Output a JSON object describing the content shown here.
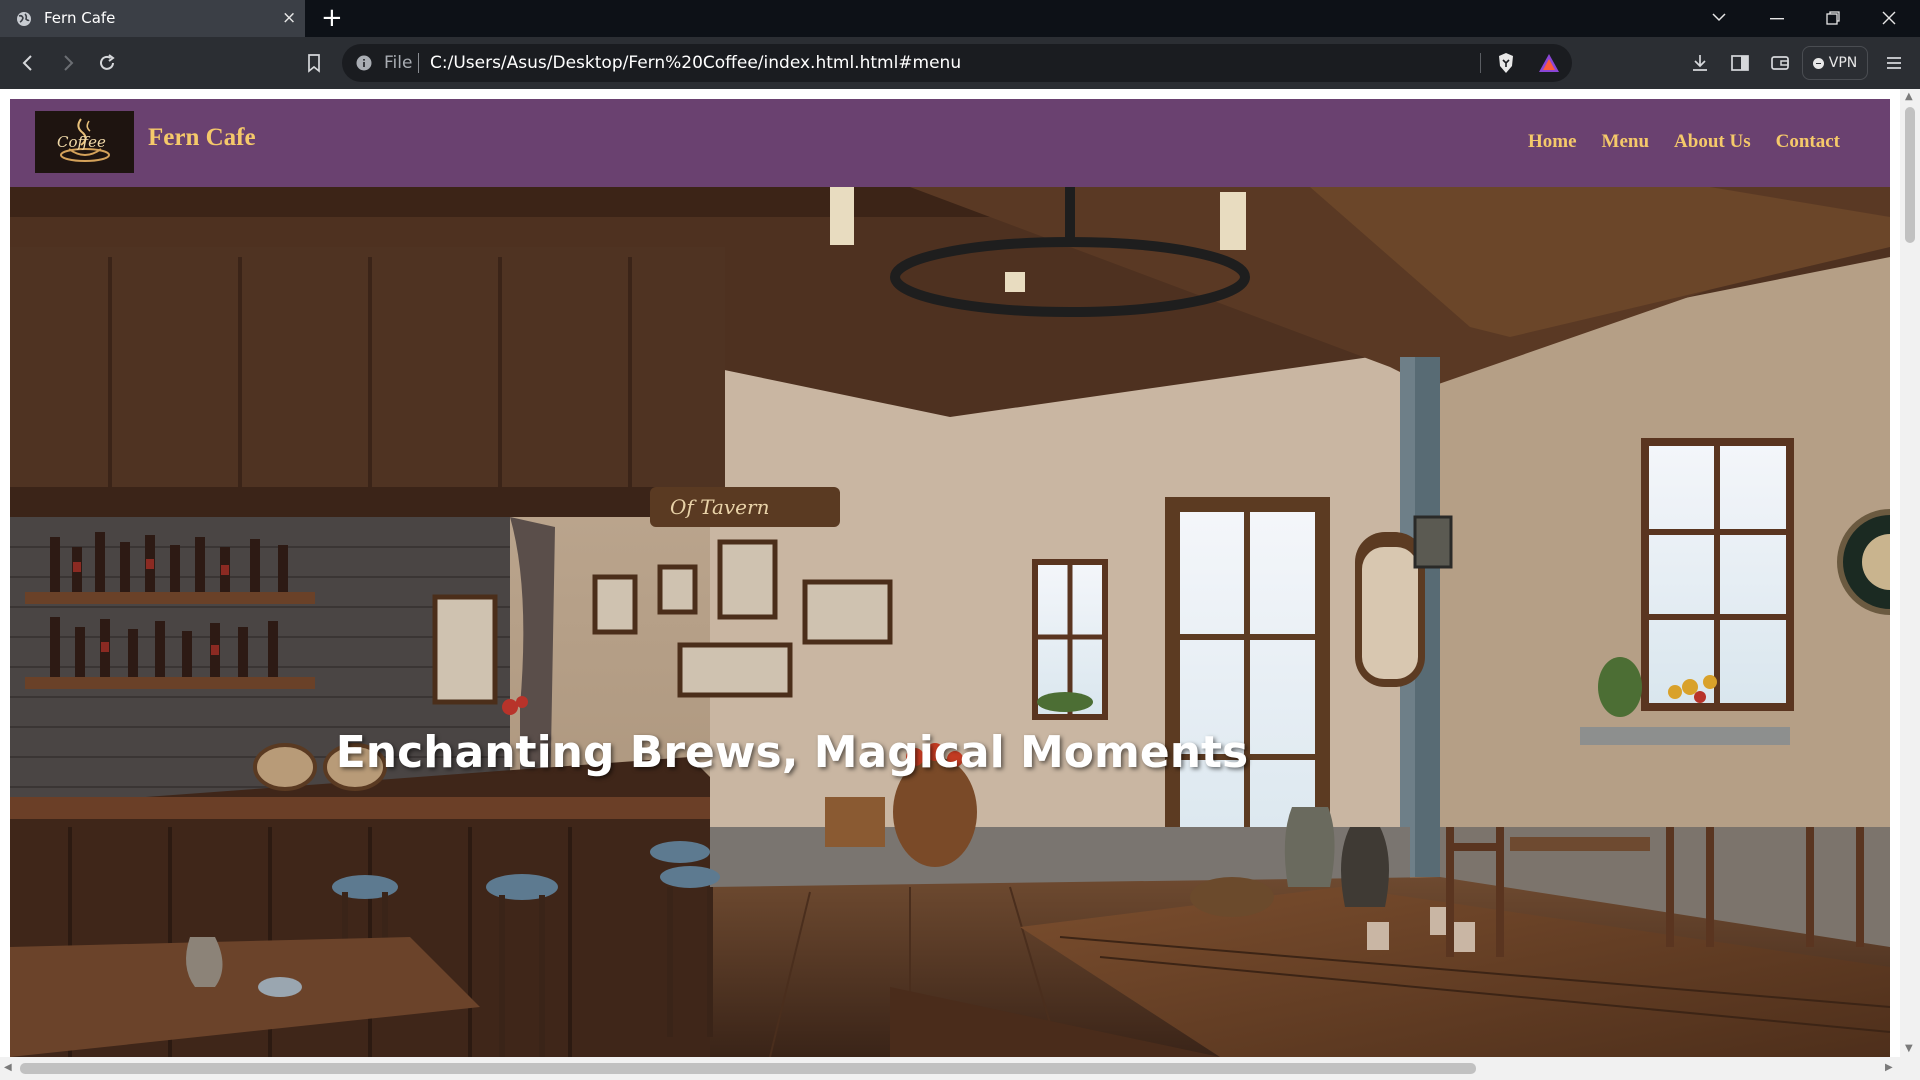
{
  "browser": {
    "tab_title": "Fern Cafe",
    "tab_close": "×",
    "new_tab": "+",
    "address_scheme": "File",
    "address_url": "C:/Users/Asus/Desktop/Fern%20Coffee/index.html.html#menu",
    "vpn_label": "VPN"
  },
  "site": {
    "logo_text": "Coffee",
    "brand": "Fern Cafe",
    "nav": [
      {
        "label": "Home"
      },
      {
        "label": "Menu"
      },
      {
        "label": "About Us"
      },
      {
        "label": "Contact"
      }
    ],
    "tagline": "Enchanting Brews, Magical Moments",
    "sign_text": "Of Tavern"
  },
  "colors": {
    "navbar": "#6a4170",
    "nav_text": "#f5c96a",
    "tab_active": "#3b3f46",
    "toolbar": "#2b2e33"
  }
}
